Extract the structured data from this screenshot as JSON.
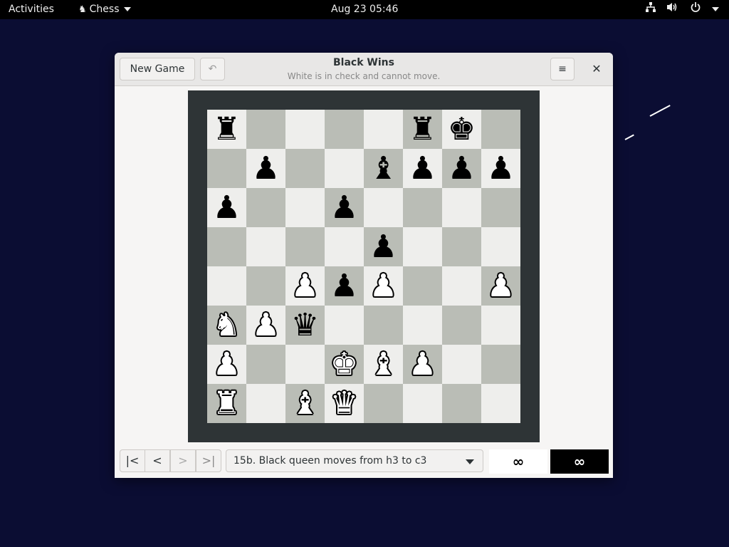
{
  "topbar": {
    "activities": "Activities",
    "app_name": "Chess",
    "app_icon": "♞",
    "clock": "Aug 23  05:46",
    "tray": {
      "network": "network-icon",
      "volume": "volume-icon",
      "power": "power-icon"
    }
  },
  "window": {
    "new_game_label": "New Game",
    "undo_icon": "↶",
    "title": "Black Wins",
    "subtitle": "White is in check and cannot move.",
    "menu_icon": "≡",
    "close_icon": "✕"
  },
  "board": {
    "rows": [
      [
        "r",
        "",
        "",
        "",
        "",
        "r",
        "k",
        ""
      ],
      [
        "",
        "p",
        "",
        "",
        "b",
        "p",
        "p",
        "p"
      ],
      [
        "p",
        "",
        "",
        "p",
        "",
        "",
        "",
        ""
      ],
      [
        "",
        "",
        "",
        "",
        "p",
        "",
        "",
        ""
      ],
      [
        "",
        "",
        "P",
        "p",
        "P",
        "",
        "",
        "P"
      ],
      [
        "N",
        "P",
        "q",
        "",
        "",
        "",
        "",
        ""
      ],
      [
        "P",
        "",
        "",
        "K",
        "B",
        "P",
        "",
        ""
      ],
      [
        "R",
        "",
        "B",
        "Q",
        "",
        "",
        "",
        ""
      ]
    ]
  },
  "bottombar": {
    "nav_first": "|<",
    "nav_prev": "<",
    "nav_next": ">",
    "nav_last": ">|",
    "move_text": "15b. Black queen moves from h3 to c3",
    "white_clock": "∞",
    "black_clock": "∞"
  }
}
